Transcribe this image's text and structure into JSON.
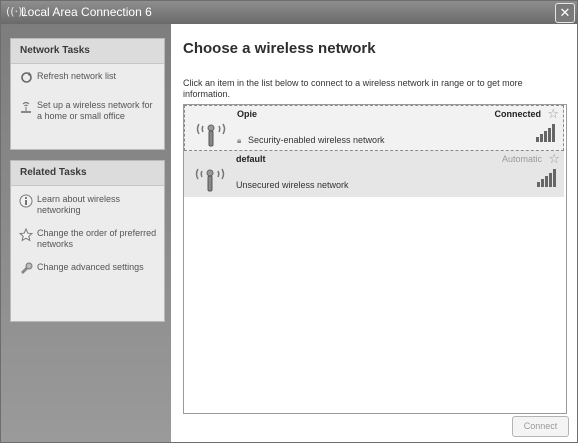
{
  "window": {
    "title": "Local Area Connection 6",
    "close_glyph": "✕"
  },
  "network_tasks": {
    "header": "Network Tasks",
    "items": [
      {
        "label": "Refresh network list",
        "icon": "refresh-icon"
      },
      {
        "label": "Set up a wireless network for a home or small office",
        "icon": "setup-network-icon"
      }
    ]
  },
  "related_tasks": {
    "header": "Related Tasks",
    "items": [
      {
        "label": "Learn about wireless networking",
        "icon": "info-icon"
      },
      {
        "label": "Change the order of preferred networks",
        "icon": "star-icon"
      },
      {
        "label": "Change advanced settings",
        "icon": "settings-icon"
      }
    ]
  },
  "main": {
    "heading": "Choose a wireless network",
    "instructions": "Click an item in the list below to connect to a wireless network in range or to get more information."
  },
  "networks": [
    {
      "name": "Opie",
      "security": "Security-enabled wireless network",
      "status": "Connected",
      "signal_bars": 5,
      "selected": true,
      "secured": true
    },
    {
      "name": "default",
      "security": "Unsecured wireless network",
      "status": "Automatic",
      "signal_bars": 5,
      "selected": false,
      "secured": false
    }
  ],
  "connect_label": "Connect"
}
